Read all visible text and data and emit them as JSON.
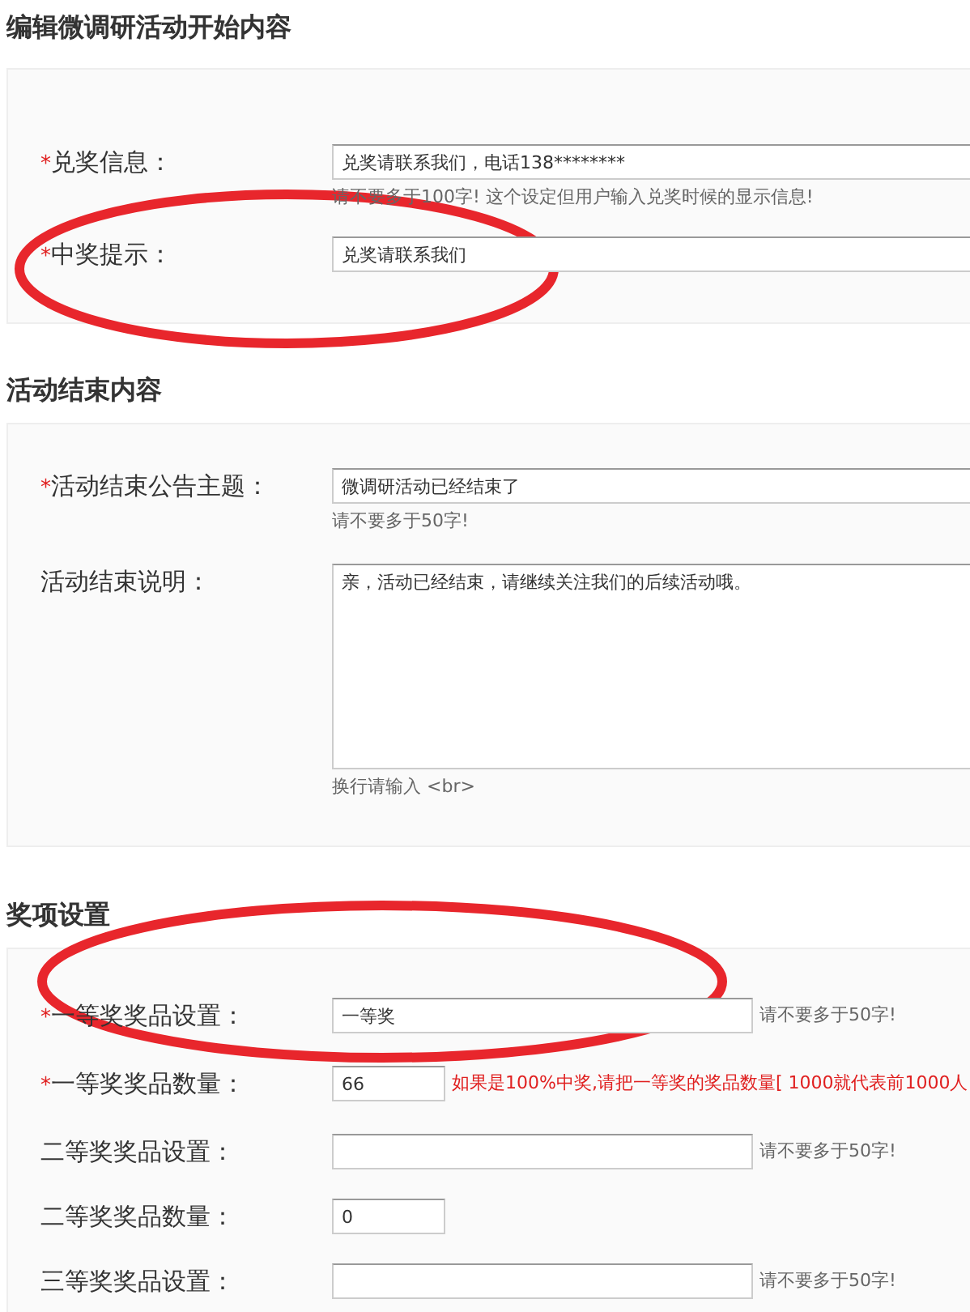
{
  "sections": [
    {
      "title": "编辑微调研活动开始内容",
      "fields": [
        {
          "label": "兑奖信息：",
          "marker": "*",
          "kind": "wide",
          "value": "兑奖请联系我们，电话138********",
          "hint": "请不要多于100字! 这个设定但用户输入兑奖时候的显示信息!",
          "hint_below": true,
          "hint_alert": false
        },
        {
          "label": "中奖提示：",
          "marker": "*",
          "kind": "wide",
          "value": "兑奖请联系我们"
        }
      ]
    },
    {
      "title": "活动结束内容",
      "fields": [
        {
          "label": "活动结束公告主题：",
          "marker": "*",
          "kind": "wide",
          "value": "微调研活动已经结束了",
          "hint": "请不要多于50字!",
          "hint_below": true,
          "hint_alert": false
        },
        {
          "label": "活动结束说明：",
          "kind": "textarea",
          "value": "亲，活动已经结束，请继续关注我们的后续活动哦。",
          "hint": "换行请输入 <br>",
          "hint_below": true,
          "hint_alert": false
        }
      ]
    },
    {
      "title": "奖项设置",
      "fields": [
        {
          "label": "一等奖奖品设置：",
          "marker": "*",
          "kind": "medium",
          "value": "一等奖",
          "hint": "请不要多于50字!",
          "hint_below": false,
          "hint_alert": false
        },
        {
          "label": "一等奖奖品数量：",
          "marker": "*",
          "kind": "short",
          "value": "66",
          "hint": "如果是100%中奖,请把一等奖的奖品数量[ 1000就代表前1000人",
          "hint_below": false,
          "hint_alert": true
        },
        {
          "label": "二等奖奖品设置：",
          "kind": "medium",
          "hint": "请不要多于50字!",
          "hint_below": false,
          "hint_alert": false
        },
        {
          "label": "二等奖奖品数量：",
          "kind": "short",
          "value": "0"
        },
        {
          "label": "三等奖奖品设置：",
          "kind": "medium",
          "hint": "请不要多于50字!",
          "hint_below": false,
          "hint_alert": false
        }
      ]
    }
  ]
}
